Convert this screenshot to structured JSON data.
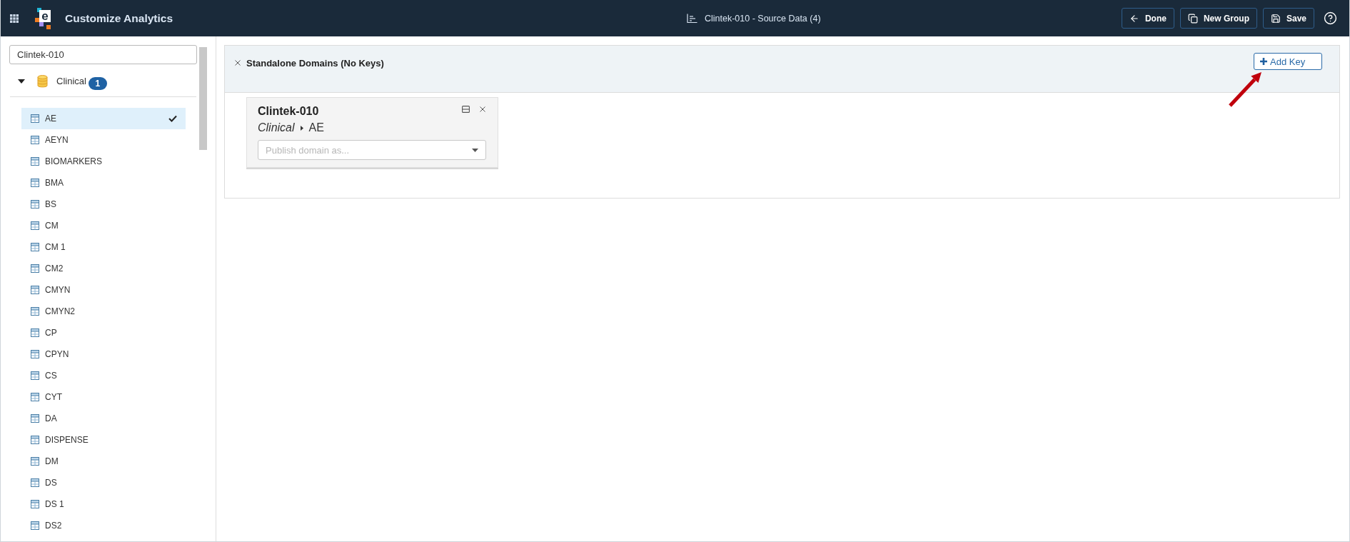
{
  "app_bar": {
    "logo": "e",
    "title": "Customize Analytics",
    "document": "Clintek-010 - Source Data (4)",
    "buttons": [
      {
        "kind": "back",
        "label": "Done"
      },
      {
        "kind": "copy",
        "label": "New Group"
      },
      {
        "kind": "save",
        "label": "Save"
      }
    ]
  },
  "sidebar": {
    "search": {
      "value": "Clintek-010"
    },
    "tree": [
      {
        "label": "Clinical",
        "badge": "1",
        "expanded": true,
        "children": [
          {
            "label": "AE",
            "selected": true
          },
          {
            "label": "AEYN",
            "selected": false
          },
          {
            "label": "BIOMARKERS",
            "selected": false
          },
          {
            "label": "BMA",
            "selected": false
          },
          {
            "label": "BS",
            "selected": false
          },
          {
            "label": "CM",
            "selected": false
          },
          {
            "label": "CM 1",
            "selected": false
          },
          {
            "label": "CM2",
            "selected": false
          },
          {
            "label": "CMYN",
            "selected": false
          },
          {
            "label": "CMYN2",
            "selected": false
          },
          {
            "label": "CP",
            "selected": false
          },
          {
            "label": "CPYN",
            "selected": false
          },
          {
            "label": "CS",
            "selected": false
          },
          {
            "label": "CYT",
            "selected": false
          },
          {
            "label": "DA",
            "selected": false
          },
          {
            "label": "DISPENSE",
            "selected": false
          },
          {
            "label": "DM",
            "selected": false
          },
          {
            "label": "DS",
            "selected": false
          },
          {
            "label": "DS 1",
            "selected": false
          },
          {
            "label": "DS2",
            "selected": false
          }
        ]
      }
    ]
  },
  "groups": [
    {
      "title": "Standalone Domains (No Keys)",
      "button": "Add Key",
      "cards": [
        {
          "title": "Clintek-010",
          "source": "Clinical",
          "domain": "AE",
          "select": {
            "placeholder": "Publish domain as..."
          }
        }
      ]
    }
  ]
}
